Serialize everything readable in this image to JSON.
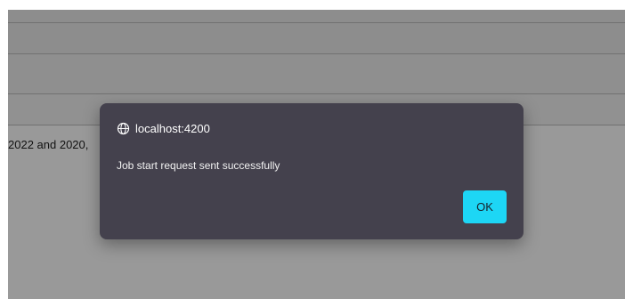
{
  "page": {
    "background_fragment": "2022 and 2020,"
  },
  "dialog": {
    "origin": "localhost:4200",
    "message": "Job start request sent successfully",
    "ok_label": "OK"
  },
  "icons": {
    "origin_icon": "globe-icon"
  },
  "colors": {
    "dialog_background": "#44414d",
    "overlay": "rgba(0, 0, 0, 0.40)",
    "ok_button": "#1dd6f5",
    "ok_text": "#17212a"
  }
}
